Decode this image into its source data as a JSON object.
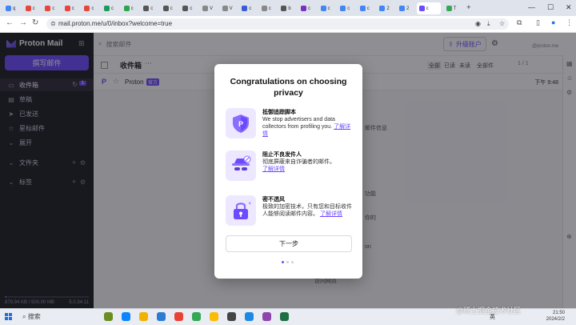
{
  "browser": {
    "tabs": [
      {
        "letter": "q",
        "color": "#4285f4"
      },
      {
        "letter": "c",
        "color": "#e8453c"
      },
      {
        "letter": "c",
        "color": "#e8453c"
      },
      {
        "letter": "c",
        "color": "#e8453c"
      },
      {
        "letter": "c",
        "color": "#e8453c"
      },
      {
        "letter": "c",
        "color": "#1a9c5a"
      },
      {
        "letter": "c",
        "color": "#2da44e"
      },
      {
        "letter": "c",
        "color": "#555555"
      },
      {
        "letter": "c",
        "color": "#555555"
      },
      {
        "letter": "c",
        "color": "#555555"
      },
      {
        "letter": "V",
        "color": "#888888"
      },
      {
        "letter": "V",
        "color": "#888888"
      },
      {
        "letter": "c",
        "color": "#3b5bdb"
      },
      {
        "letter": "c",
        "color": "#888888"
      },
      {
        "letter": "b",
        "color": "#555555"
      },
      {
        "letter": "c",
        "color": "#7b2fbe"
      },
      {
        "letter": "c",
        "color": "#4285f4"
      },
      {
        "letter": "c",
        "color": "#4285f4"
      },
      {
        "letter": "c",
        "color": "#4285f4"
      },
      {
        "letter": "2",
        "color": "#4285f4"
      },
      {
        "letter": "2",
        "color": "#4285f4"
      },
      {
        "letter": "T",
        "color": "#34a853"
      }
    ],
    "active_tab": {
      "letter": "c",
      "color": "#6d4aff"
    },
    "url": "mail.proton.me/u/0/inbox?welcome=true"
  },
  "app": {
    "brand": "Proton Mail",
    "compose_label": "撰写邮件",
    "nav": [
      {
        "id": "inbox",
        "label": "收件箱",
        "icon": "inbox-icon",
        "glyph": "▭",
        "badge": "1",
        "selected": true
      },
      {
        "id": "drafts",
        "label": "草稿",
        "icon": "draft-icon",
        "glyph": "▤"
      },
      {
        "id": "sent",
        "label": "已发送",
        "icon": "send-icon",
        "glyph": "➤"
      },
      {
        "id": "starred",
        "label": "星标邮件",
        "icon": "star-icon",
        "glyph": "☆"
      },
      {
        "id": "expand",
        "label": "展开",
        "icon": "chevron-down-icon",
        "glyph": "⌄"
      }
    ],
    "folders_label": "文件夹",
    "labels_label": "标签",
    "storage": "879.94 KB / 500.00 MB",
    "storage_ratio": 0.002,
    "version": "5.0.34.11",
    "search_placeholder": "搜索邮件",
    "upgrade_label": "升级账户",
    "account_email": "@proton.me",
    "folder_title": "收件箱",
    "filters": [
      "全部",
      "已读",
      "未读",
      "全部件"
    ],
    "pager": "1 / 1",
    "message": {
      "sender": "Proton",
      "tag": "官方",
      "time": "下午 9:48"
    },
    "behind": [
      "邮件信息",
      "你的",
      "on",
      "功能",
      "访问网页"
    ]
  },
  "modal": {
    "title": "Congratulations on choosing privacy",
    "features": [
      {
        "title": "抵御追踪脚本",
        "desc": "We stop advertisers and data collectors from profiling you.",
        "link": "了解详情",
        "icon": "shield-p-icon"
      },
      {
        "title": "阻止不良发件人",
        "desc": "彻底屏蔽来自诈骗者的邮件。",
        "link": "了解详情",
        "icon": "spy-block-icon"
      },
      {
        "title": "密不透风",
        "desc": "极致的加密技术，只有您和目标收件人能够阅读邮件内容。",
        "link": "了解详情",
        "icon": "lock-icon"
      }
    ],
    "next_label": "下一步",
    "step": 1,
    "steps": 3
  },
  "taskbar": {
    "search_label": "搜索",
    "tray_lang": "英",
    "clock_time": "21:50",
    "clock_date": "2024/2/2",
    "apps": [
      {
        "color": "#6b8e23"
      },
      {
        "color": "#0a84ff"
      },
      {
        "color": "#f2b200"
      },
      {
        "color": "#2b7cd3"
      },
      {
        "color": "#ea4335"
      },
      {
        "color": "#34a853"
      },
      {
        "color": "#fbbc05"
      },
      {
        "color": "#444444"
      },
      {
        "color": "#1e88e5"
      },
      {
        "color": "#8e44ad"
      },
      {
        "color": "#1d6f42"
      }
    ]
  },
  "watermark": "@稀土掘金技术社区"
}
